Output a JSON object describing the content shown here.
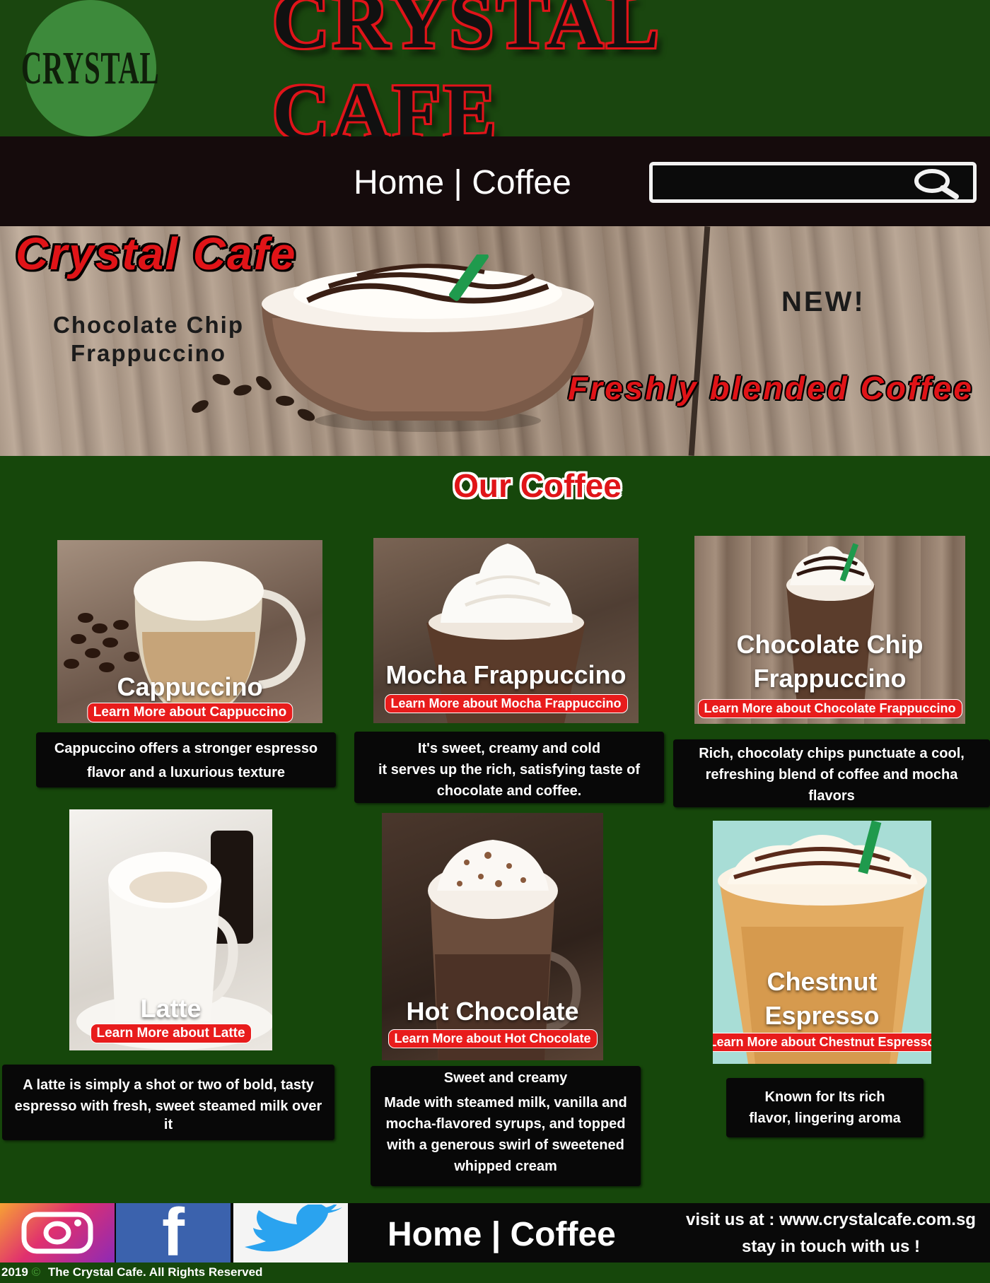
{
  "header": {
    "logo_text": "CRYSTAL",
    "brand": "CRYSTAL CAFE"
  },
  "nav": {
    "home": "Home",
    "separator": "|",
    "coffee": "Coffee"
  },
  "search": {
    "value": "",
    "placeholder": ""
  },
  "hero": {
    "title": "Crystal Cafe",
    "subtitle": "Chocolate Chip Frappuccino",
    "badge": "NEW!",
    "tagline": "Freshly blended Coffee"
  },
  "section_title": "Our Coffee",
  "products": [
    {
      "name": "Cappuccino",
      "button": "Learn More about Cappuccino",
      "description": [
        "Cappuccino offers a stronger espresso",
        "flavor and a luxurious texture"
      ]
    },
    {
      "name": "Mocha Frappuccino",
      "button": "Learn More about Mocha Frappuccino",
      "description": [
        "It's sweet, creamy and cold",
        "it serves up the rich, satisfying taste of",
        "chocolate and coffee."
      ]
    },
    {
      "name": "Chocolate Chip Frappuccino",
      "button": "Learn More about Chocolate Frappuccino",
      "description": [
        "Rich, chocolaty chips punctuate a cool,",
        "refreshing blend of coffee and mocha",
        "flavors"
      ]
    },
    {
      "name": "Latte",
      "button": "Learn More about  Latte",
      "description": [
        "A latte is simply a shot or two of bold, tasty",
        "espresso with fresh, sweet steamed milk over",
        "it"
      ]
    },
    {
      "name": "Hot Chocolate",
      "button": "Learn More about  Hot Chocolate",
      "description": [
        "Sweet and creamy",
        "Made with steamed milk, vanilla and",
        "mocha-flavored syrups, and topped",
        "with a generous swirl of sweetened",
        "whipped cream"
      ]
    },
    {
      "name": "Chestnut Espresso",
      "button": "Learn More about  Chestnut Espresso",
      "description": [
        "Known for Its rich",
        "flavor, lingering aroma"
      ]
    }
  ],
  "footer": {
    "social": [
      "instagram-icon",
      "facebook-icon",
      "twitter-icon"
    ],
    "facebook_glyph": "f",
    "nav_home": "Home",
    "nav_separator": "|",
    "nav_coffee": "Coffee",
    "visit": "visit us at : www.crystalcafe.com.sg",
    "touch": "stay in touch with us !",
    "year": "2019",
    "copyright_symbol": "©",
    "rights": "The Crystal Cafe. All Rights Reserved"
  },
  "colors": {
    "page_bg": "#16470b",
    "nav_bg": "#150b0c",
    "accent_red": "#e01418",
    "button_red": "#e81c1c",
    "desc_bg": "#080808"
  }
}
